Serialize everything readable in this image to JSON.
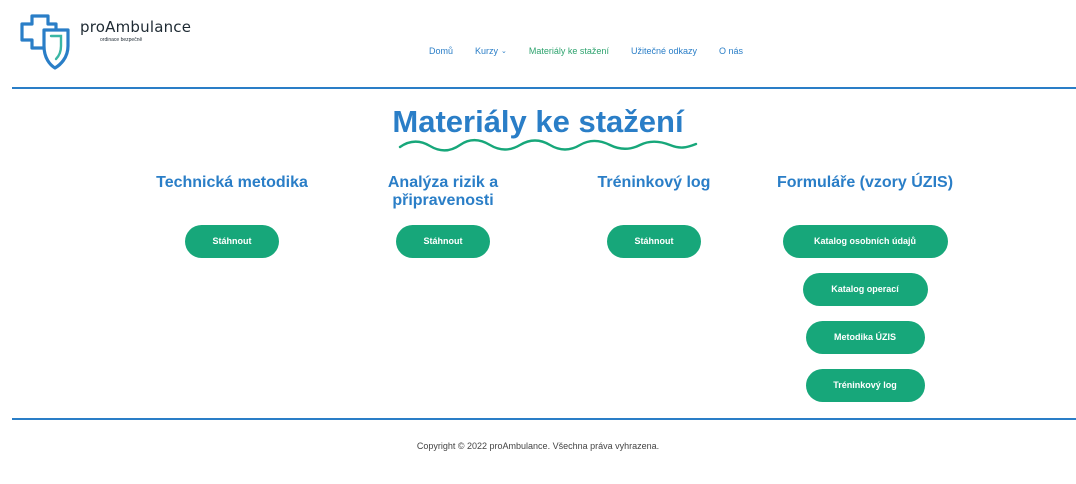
{
  "brand": {
    "name": "proAmbulance",
    "tagline": "ordinace bezpečně",
    "colors": {
      "primary": "#2a7ec7",
      "accent": "#17a77a",
      "nav_active": "#2ea36e"
    }
  },
  "nav": {
    "items": [
      {
        "label": "Domů"
      },
      {
        "label": "Kurzy",
        "icon": "chevron-down-icon"
      },
      {
        "label": "Materiály ke stažení",
        "active": true
      },
      {
        "label": "Užitečné odkazy"
      },
      {
        "label": "O nás"
      }
    ]
  },
  "page": {
    "title": "Materiály ke stažení"
  },
  "columns": [
    {
      "title": "Technická metodika",
      "buttons": [
        "Stáhnout"
      ]
    },
    {
      "title": "Analýza rizik a připravenosti",
      "buttons": [
        "Stáhnout"
      ]
    },
    {
      "title": "Tréninkový log",
      "buttons": [
        "Stáhnout"
      ]
    },
    {
      "title": "Formuláře (vzory ÚZIS)",
      "buttons": [
        "Katalog osobních údajů",
        "Katalog operací",
        "Metodika ÚZIS",
        "Tréninkový log"
      ]
    }
  ],
  "footer": {
    "copyright": "Copyright © 2022 proAmbulance. Všechna práva vyhrazena."
  }
}
